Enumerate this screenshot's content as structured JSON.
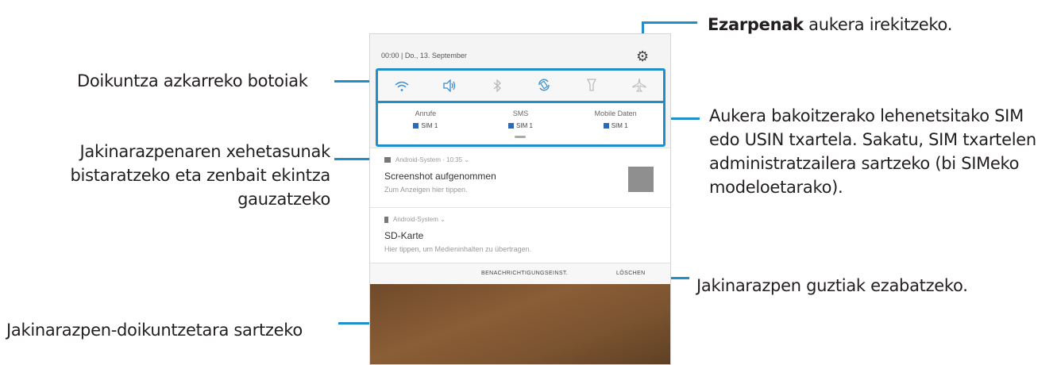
{
  "callouts": {
    "settings_bold": "Ezarpenak",
    "settings_rest": " aukera irekitzeko.",
    "quick_buttons": "Doikuntza azkarreko botoiak",
    "sim_line1": "Aukera bakoitzerako lehenetsitako SIM",
    "sim_line2": "edo USIN txartela. Sakatu, SIM txartelen",
    "sim_line3": "administratzailera sartzeko (bi SIMeko",
    "sim_line4": "modeloetarako).",
    "details_line1": "Jakinarazpenaren xehetasunak",
    "details_line2": "bistaratzeko eta zenbait ekintza",
    "details_line3": "gauzatzeko",
    "clear_all": "Jakinarazpen guztiak ezabatzeko.",
    "notif_settings": "Jakinarazpen-doikuntzetara sartzeko"
  },
  "panel": {
    "status": "00:00  |  Do., 13. September",
    "quick_icons": [
      {
        "name": "wifi-icon",
        "glyph": "≋",
        "active": true
      },
      {
        "name": "sound-icon",
        "glyph": "🔈",
        "active": true
      },
      {
        "name": "bluetooth-icon",
        "glyph": "ᛒ",
        "active": false
      },
      {
        "name": "auto-rotate-icon",
        "glyph": "⟳",
        "active": true
      },
      {
        "name": "flashlight-icon",
        "glyph": "♡",
        "active": false
      },
      {
        "name": "airplane-icon",
        "glyph": "✈",
        "active": false
      }
    ],
    "sims": [
      {
        "label": "Anrufe",
        "sim": "SIM 1"
      },
      {
        "label": "SMS",
        "sim": "SIM 1"
      },
      {
        "label": "Mobile Daten",
        "sim": "SIM 1"
      }
    ],
    "notif1": {
      "app": "Android-System · 10:35",
      "title": "Screenshot aufgenommen",
      "text": "Zum Anzeigen hier tippen."
    },
    "notif2": {
      "app": "Android-System",
      "title": "SD-Karte",
      "text": "Hier tippen, um Medieninhalten zu übertragen."
    },
    "actions": {
      "settings": "BENACHRICHTIGUNGSEINST.",
      "clear": "LÖSCHEN"
    }
  }
}
